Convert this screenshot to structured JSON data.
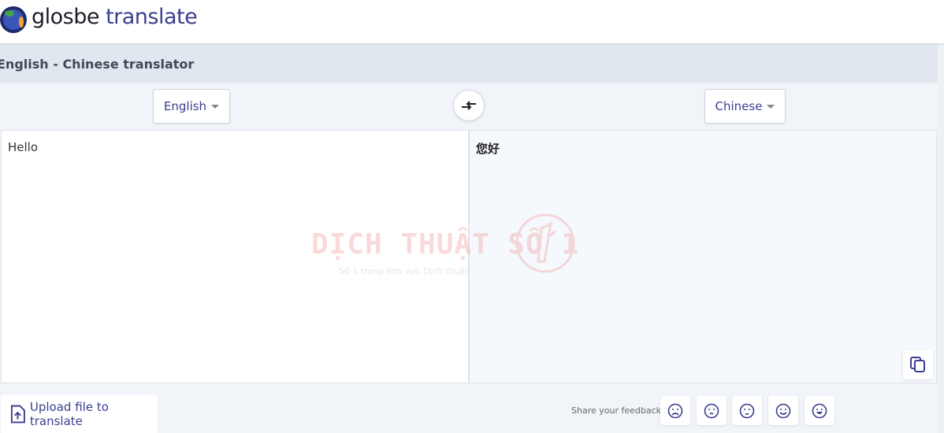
{
  "header": {
    "brand_main": "glosbe",
    "brand_sub": "translate"
  },
  "page_title": "English - Chinese translator",
  "source_language": "English",
  "target_language": "Chinese",
  "source_text": "Hello",
  "translated_text": "您好",
  "upload_label": "Upload file to translate",
  "feedback": {
    "label": "Share your feedback:",
    "options": [
      "very-sad",
      "sad",
      "neutral",
      "happy",
      "very-happy"
    ]
  },
  "watermark": {
    "title": "DỊCH THUẬT SỐ 1",
    "subtitle": "Số 1 trong lĩnh vực Dịch thuật"
  },
  "colors": {
    "accent": "#3b3f8f",
    "title_bar": "#e1e7ef"
  }
}
